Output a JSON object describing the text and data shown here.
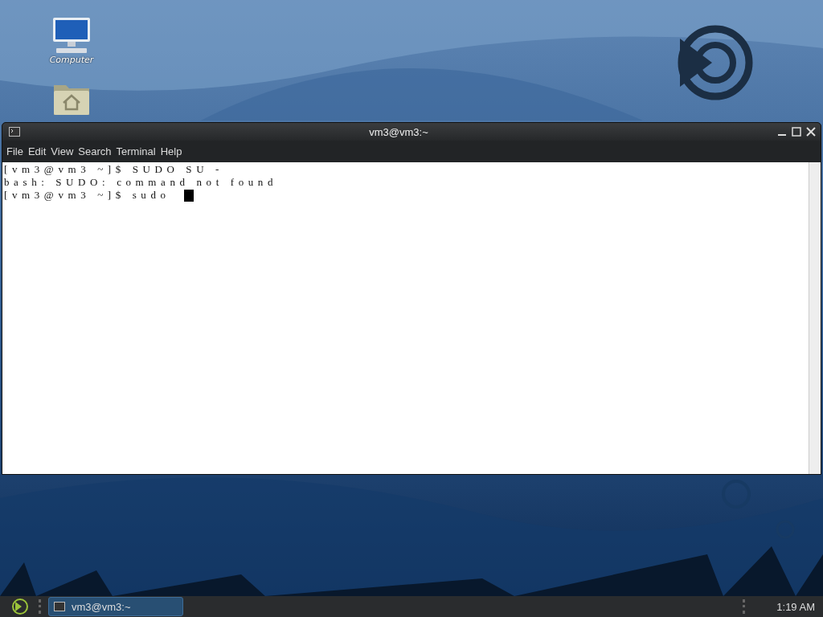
{
  "desktop_icons": [
    {
      "kind": "computer",
      "label": "Computer"
    },
    {
      "kind": "home"
    }
  ],
  "window": {
    "title": "vm3@vm3:~",
    "menu": [
      "File",
      "Edit",
      "View",
      "Search",
      "Terminal",
      "Help"
    ],
    "terminal_lines": [
      "[vm3@vm3 ~]$ SUDO SU -",
      "bash: SUDO: command not found",
      "[vm3@vm3 ~]$ sudo "
    ]
  },
  "taskbar": {
    "tasks": [
      {
        "label": "vm3@vm3:~",
        "selected": true
      }
    ],
    "clock": "1:19 AM"
  }
}
